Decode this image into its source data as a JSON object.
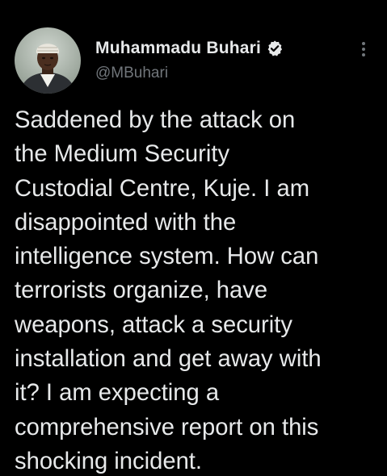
{
  "tweet": {
    "author": {
      "display_name": "Muhammadu Buhari",
      "handle": "@MBuhari",
      "verified": true,
      "avatar_icon": "profile-photo"
    },
    "more_icon": "more-vertical-icon",
    "text_lines": [
      "Saddened by the attack on",
      "the Medium Security",
      "Custodial Centre, Kuje. I am",
      "disappointed with the",
      "intelligence system. How can",
      "terrorists organize, have",
      "weapons, attack a security",
      "installation and get away with",
      "it? I am expecting a",
      "comprehensive report on this",
      "shocking incident."
    ]
  },
  "colors": {
    "background": "#000000",
    "text_primary": "#e7e9ea",
    "text_secondary": "#71767b",
    "verified_badge": "#e7e9ea"
  }
}
